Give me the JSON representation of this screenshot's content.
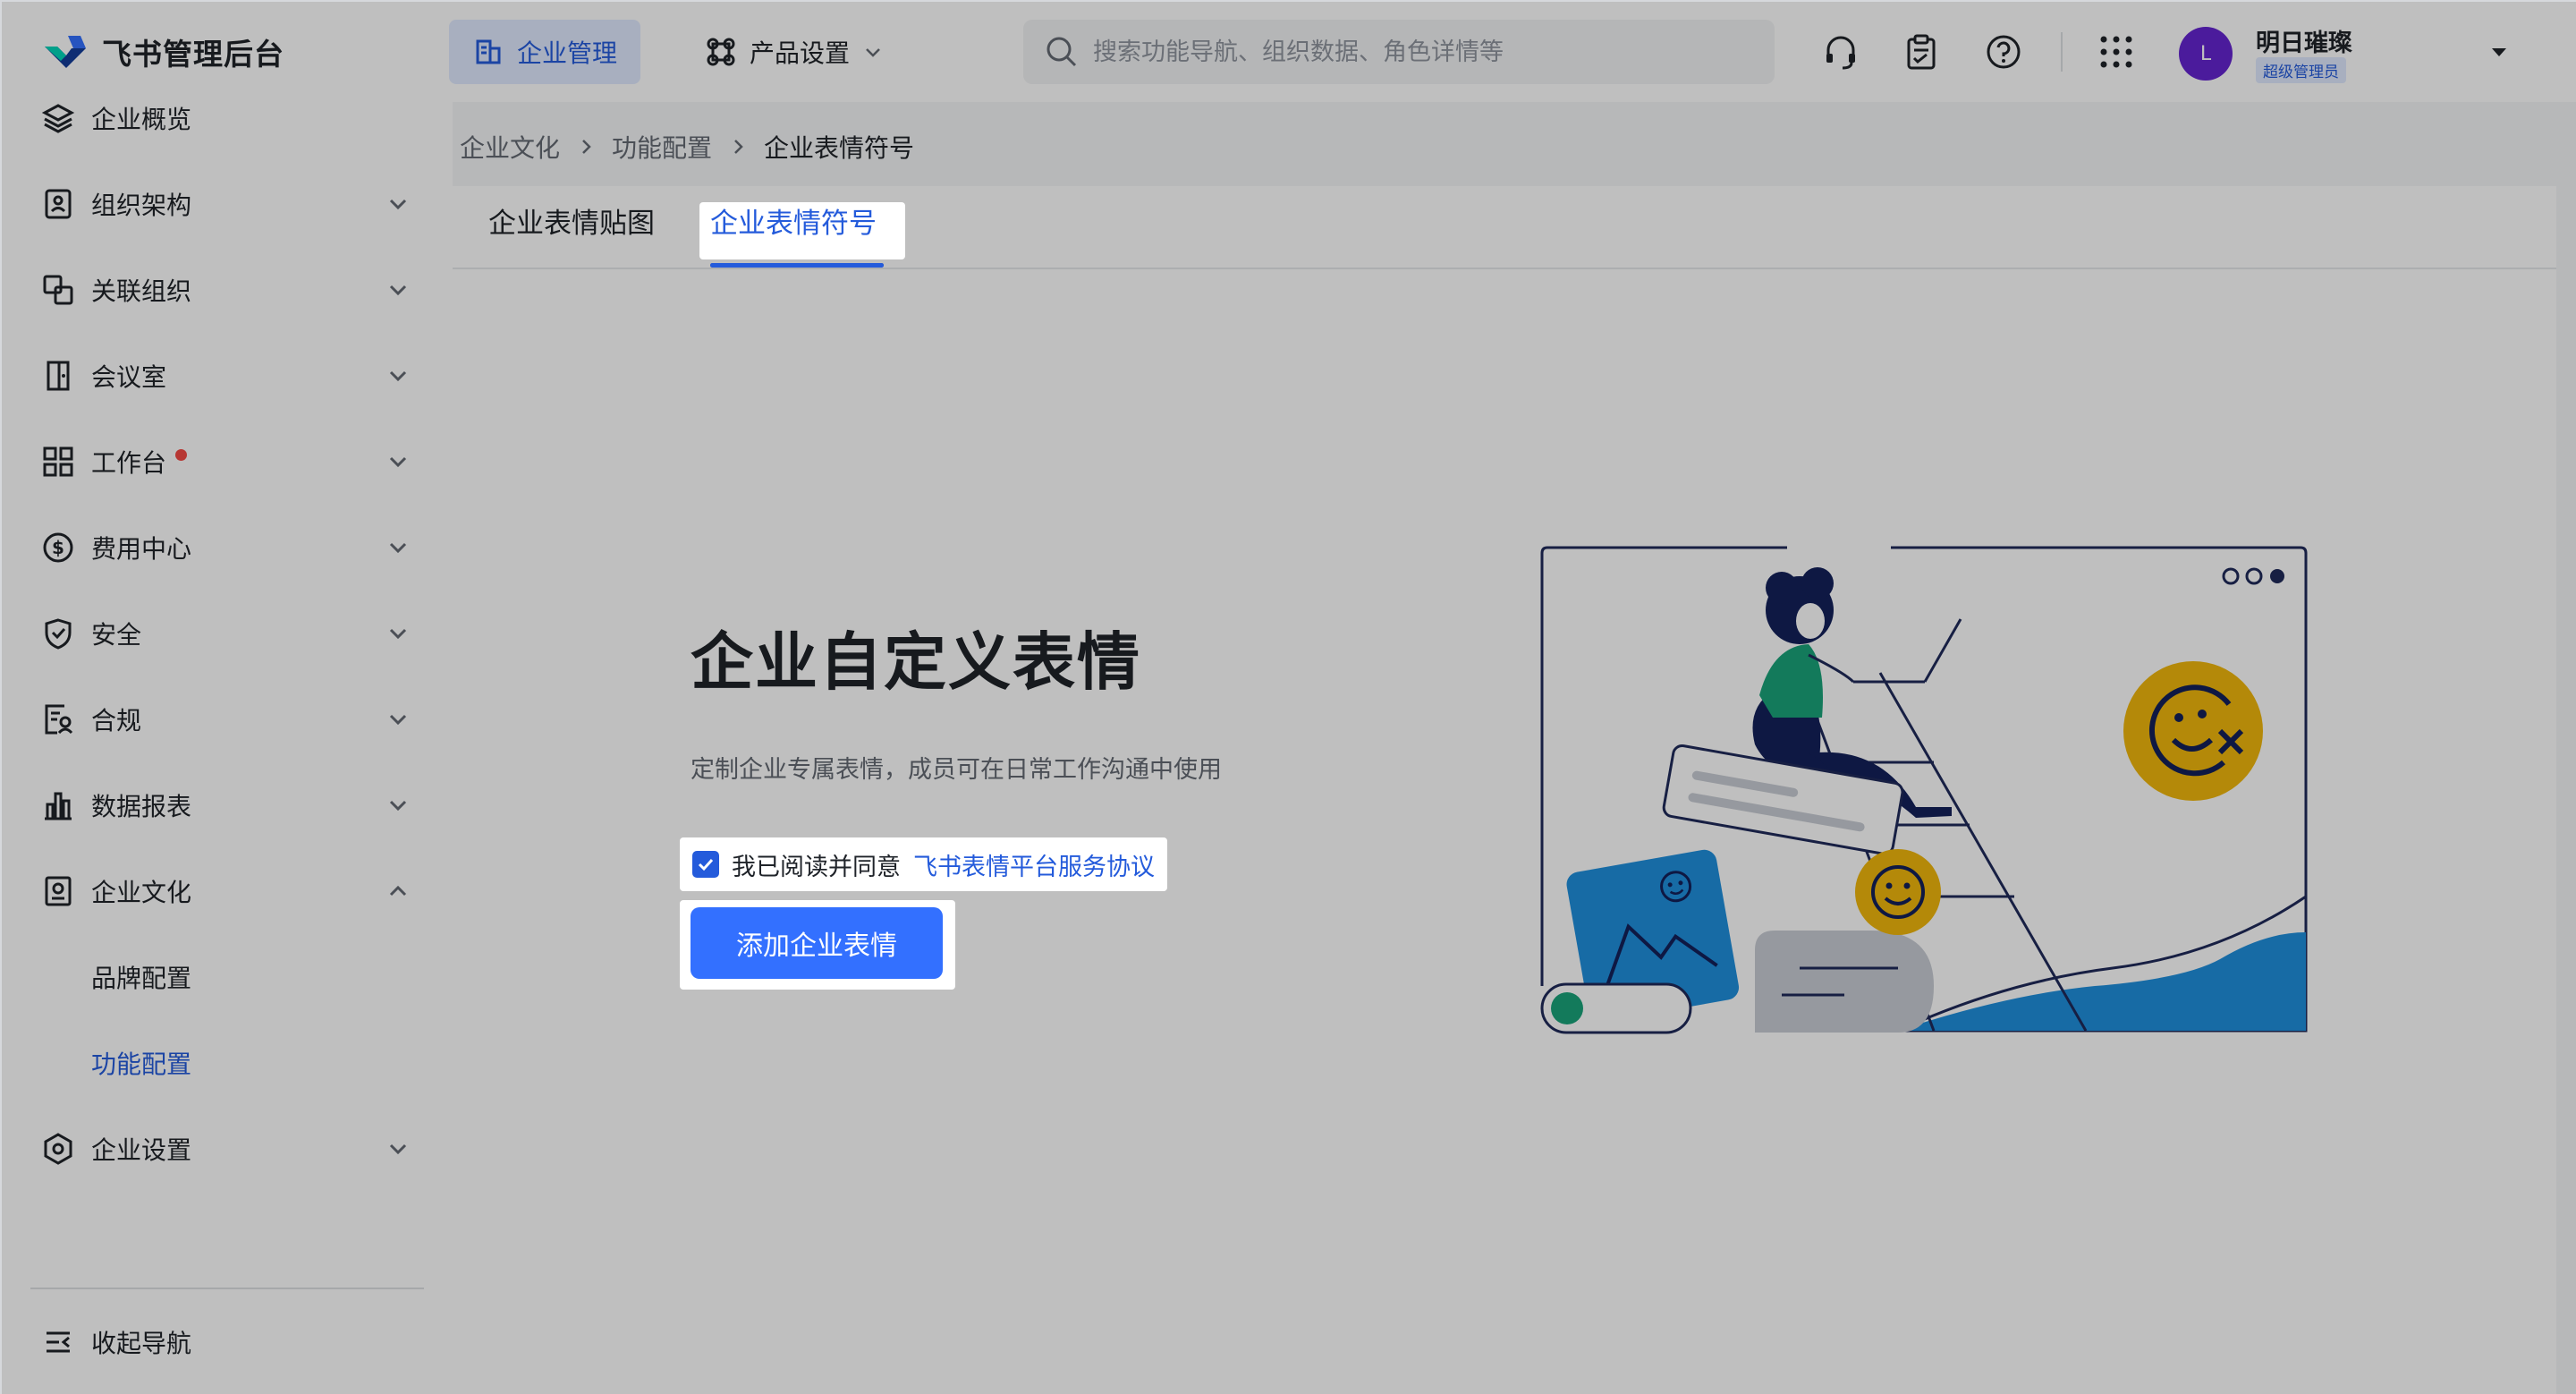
{
  "header": {
    "logo_text": "飞书管理后台",
    "nav_enterprise": "企业管理",
    "nav_product": "产品设置",
    "search_placeholder": "搜索功能导航、组织数据、角色详情等",
    "user": {
      "avatar_letter": "L",
      "name": "明日璀璨",
      "role": "超级管理员"
    }
  },
  "sidebar": {
    "items": [
      {
        "label": "企业概览",
        "icon": "layers-icon"
      },
      {
        "label": "组织架构",
        "icon": "org-icon"
      },
      {
        "label": "关联组织",
        "icon": "link-org-icon"
      },
      {
        "label": "会议室",
        "icon": "door-icon"
      },
      {
        "label": "工作台",
        "icon": "grid-icon"
      },
      {
        "label": "费用中心",
        "icon": "dollar-icon"
      },
      {
        "label": "安全",
        "icon": "shield-icon"
      },
      {
        "label": "合规",
        "icon": "compliance-icon"
      },
      {
        "label": "数据报表",
        "icon": "bar-chart-icon"
      },
      {
        "label": "企业文化",
        "icon": "culture-icon"
      },
      {
        "label": "品牌配置"
      },
      {
        "label": "功能配置"
      },
      {
        "label": "企业设置",
        "icon": "settings-icon"
      }
    ],
    "collapse_label": "收起导航"
  },
  "breadcrumb": [
    "企业文化",
    "功能配置",
    "企业表情符号"
  ],
  "tabs": [
    "企业表情贴图",
    "企业表情符号"
  ],
  "content": {
    "title": "企业自定义表情",
    "subtitle": "定制企业专属表情，成员可在日常工作沟通中使用",
    "agree_text": "我已阅读并同意",
    "agree_link": "飞书表情平台服务协议",
    "button_label": "添加企业表情"
  },
  "colors": {
    "accent": "#245bdb",
    "button": "#3370ff",
    "badge_dot": "#f54a45"
  }
}
